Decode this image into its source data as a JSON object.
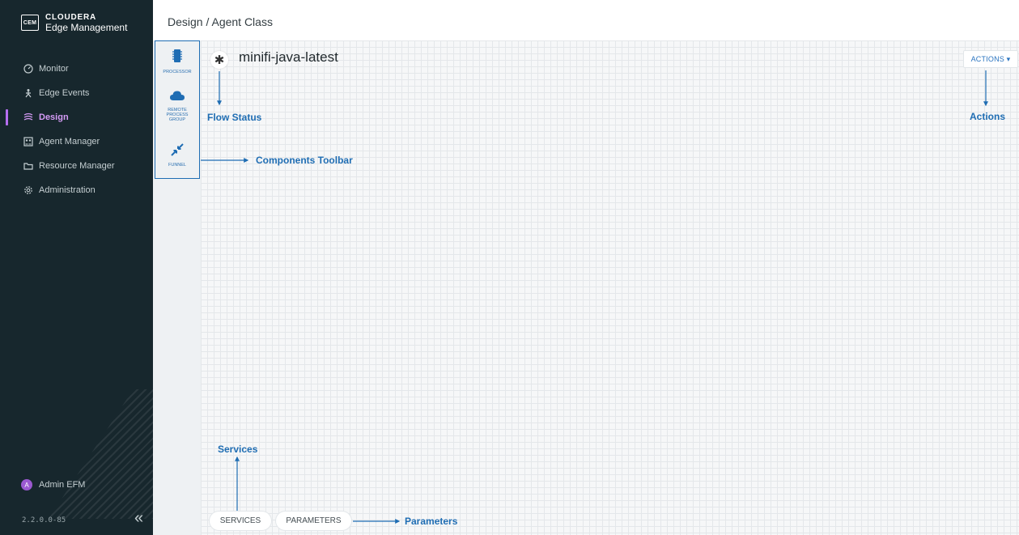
{
  "app": {
    "brand_logo": "CEM",
    "brand_line1": "CLOUDERA",
    "brand_line2": "Edge Management"
  },
  "sidebar": {
    "items": [
      {
        "label": "Monitor",
        "icon": "gauge-icon"
      },
      {
        "label": "Edge Events",
        "icon": "person-icon"
      },
      {
        "label": "Design",
        "icon": "flow-icon",
        "active": true
      },
      {
        "label": "Agent Manager",
        "icon": "agents-icon"
      },
      {
        "label": "Resource Manager",
        "icon": "folder-icon"
      },
      {
        "label": "Administration",
        "icon": "gear-icon"
      }
    ],
    "user_initial": "A",
    "user_name": "Admin EFM",
    "version": "2.2.0.0-85",
    "collapse_icon": "double-chevron-left-icon"
  },
  "header": {
    "breadcrumb": "Design / Agent Class"
  },
  "toolbar": {
    "processor": "PROCESSOR",
    "remote_line1": "REMOTE",
    "remote_line2": "PROCESS",
    "remote_line3": "GROUP",
    "funnel": "FUNNEL"
  },
  "flow": {
    "status_icon": "asterisk-icon",
    "name": "minifi-java-latest"
  },
  "actions": {
    "label": "ACTIONS ▾"
  },
  "bottom": {
    "services": "SERVICES",
    "parameters": "PARAMETERS"
  },
  "annotations": {
    "flow_status": "Flow Status",
    "components_toolbar": "Components Toolbar",
    "actions": "Actions",
    "services": "Services",
    "parameters": "Parameters",
    "color": "#1f6db3"
  },
  "colors": {
    "sidebar_bg": "#17272d",
    "active_nav": "#d59bf6",
    "accent": "#1f6db3"
  }
}
